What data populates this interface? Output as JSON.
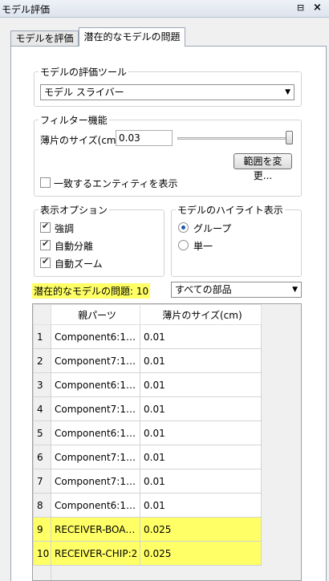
{
  "window": {
    "title": "モデル評価",
    "pin_glyph": "⊟",
    "close_glyph": "×"
  },
  "tabs": [
    {
      "label": "モデルを評価",
      "active": false
    },
    {
      "label": "潜在的なモデルの問題",
      "active": true
    }
  ],
  "eval_tool": {
    "group_label": "モデルの評価ツール",
    "selected": "モデル スライバー"
  },
  "filter": {
    "group_label": "フィルター機能",
    "sliver_size_label": "薄片のサイズ(cm)",
    "sliver_size_value": "0.03",
    "slider_level": 1.0,
    "change_range_button": "範囲を変更...",
    "show_matching_label": "一致するエンティティを表示",
    "show_matching_checked": false
  },
  "display_options": {
    "group_label": "表示オプション",
    "items": [
      {
        "label": "強調",
        "checked": true
      },
      {
        "label": "自動分離",
        "checked": true
      },
      {
        "label": "自動ズーム",
        "checked": true
      }
    ]
  },
  "model_highlight": {
    "group_label": "モデルのハイライト表示",
    "items": [
      {
        "label": "グループ",
        "checked": true
      },
      {
        "label": "単一",
        "checked": false
      }
    ]
  },
  "issues": {
    "count_label": "潜在的なモデルの問題: 10",
    "filter_selected": "すべての部品"
  },
  "table": {
    "columns": [
      "親パーツ",
      "薄片のサイズ(cm)"
    ],
    "rows": [
      {
        "num": "1",
        "part": "Component6:1…",
        "size": "0.01",
        "highlighted": false
      },
      {
        "num": "2",
        "part": "Component7:1…",
        "size": "0.01",
        "highlighted": false
      },
      {
        "num": "3",
        "part": "Component6:1…",
        "size": "0.01",
        "highlighted": false
      },
      {
        "num": "4",
        "part": "Component7:1…",
        "size": "0.01",
        "highlighted": false
      },
      {
        "num": "5",
        "part": "Component6:1…",
        "size": "0.01",
        "highlighted": false
      },
      {
        "num": "6",
        "part": "Component7:1…",
        "size": "0.01",
        "highlighted": false
      },
      {
        "num": "7",
        "part": "Component7:1…",
        "size": "0.01",
        "highlighted": false
      },
      {
        "num": "8",
        "part": "Component6:1…",
        "size": "0.01",
        "highlighted": false
      },
      {
        "num": "9",
        "part": "RECEIVER-BOA…",
        "size": "0.025",
        "highlighted": true
      },
      {
        "num": "10",
        "part": "RECEIVER-CHIP:2",
        "size": "0.025",
        "highlighted": true
      }
    ]
  },
  "colors": {
    "highlight": "#ffff66",
    "radio_accent": "#1f58b0"
  }
}
